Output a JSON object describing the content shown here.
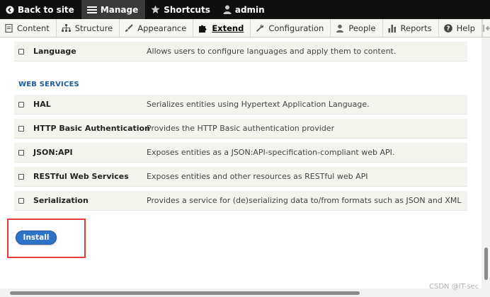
{
  "toolbar": {
    "back": "Back to site",
    "manage": "Manage",
    "shortcuts": "Shortcuts",
    "user": "admin"
  },
  "tray": {
    "items": [
      "Content",
      "Structure",
      "Appearance",
      "Extend",
      "Configuration",
      "People",
      "Reports",
      "Help"
    ],
    "active": "Extend"
  },
  "modules": {
    "language": {
      "name": "Language",
      "desc": "Allows users to configure languages and apply them to content."
    },
    "section_title": "WEB SERVICES",
    "hal": {
      "name": "HAL",
      "desc": "Serializes entities using Hypertext Application Language."
    },
    "basic_auth": {
      "name": "HTTP Basic Authentication",
      "desc": "Provides the HTTP Basic authentication provider"
    },
    "jsonapi": {
      "name": "JSON:API",
      "desc": "Exposes entities as a JSON:API-specification-compliant web API."
    },
    "rest": {
      "name": "RESTful Web Services",
      "desc": "Exposes entities and other resources as RESTful web API"
    },
    "serialization": {
      "name": "Serialization",
      "desc": "Provides a service for (de)serializing data to/from formats such as JSON and XML"
    }
  },
  "install_label": "Install",
  "watermark": "CSDN @IT-sec",
  "colors": {
    "accent": "#2d74c9",
    "highlight": "#e53b3b",
    "section": "#1d5a9c"
  }
}
